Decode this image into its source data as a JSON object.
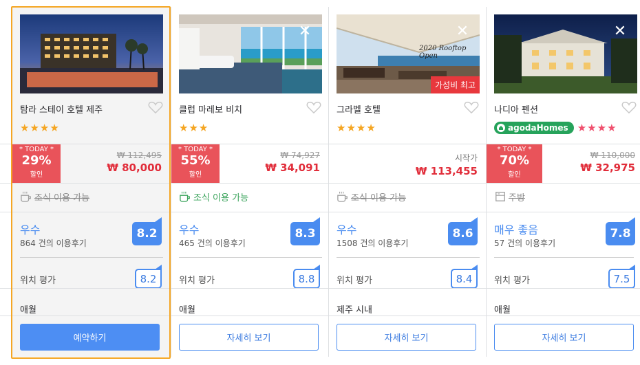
{
  "colors": {
    "accent": "#4a8cf0",
    "price_red": "#e12d3a",
    "badge_red": "#e9535a",
    "star": "#f5a623",
    "star_pink": "#f0506e",
    "selected_border": "#f5a623",
    "homes_green": "#26a35b"
  },
  "hotels": [
    {
      "name": "탐라 스테이 호텔 제주",
      "stars": 4,
      "today_label": "* TODAY *",
      "discount": "29%",
      "discount_label": "할인",
      "old_price": "₩ 112,495",
      "price": "₩ 80,000",
      "breakfast": "조식 이용 가능",
      "review_word": "우수",
      "review_count": "864 건의 이용후기",
      "score": "8.2",
      "location_label": "위치 평가",
      "location_score": "8.2",
      "area": "애월",
      "button": "예약하기",
      "icons": [
        "heart-icon",
        "star-icon",
        "coffee-cup-icon"
      ]
    },
    {
      "name": "클럽 마레보 비치",
      "stars": 3,
      "today_label": "* TODAY *",
      "discount": "55%",
      "discount_label": "할인",
      "old_price": "₩ 74,927",
      "price": "₩ 34,091",
      "breakfast": "조식 이용 가능",
      "review_word": "우수",
      "review_count": "465 건의 이용후기",
      "score": "8.3",
      "location_label": "위치 평가",
      "location_score": "8.8",
      "area": "애월",
      "button": "자세히 보기",
      "close": "✕"
    },
    {
      "name": "그라벨 호텔",
      "stars": 4,
      "from_label": "시작가",
      "price": "₩ 113,455",
      "breakfast": "조식 이용 가능",
      "review_word": "우수",
      "review_count": "1508 건의 이용후기",
      "score": "8.6",
      "location_label": "위치 평가",
      "location_score": "8.4",
      "area": "제주 시내",
      "button": "자세히 보기",
      "close": "✕",
      "promo_badge": "가성비 최고",
      "photo_text": "2020 Rooftop Open"
    },
    {
      "name": "나디아 펜션",
      "homes_badge": "agodaHomes",
      "stars": 4,
      "today_label": "* TODAY *",
      "discount": "70%",
      "discount_label": "할인",
      "old_price": "₩ 110,000",
      "price": "₩ 32,975",
      "breakfast": "주방",
      "review_word": "매우 좋음",
      "review_count": "57 건의 이용후기",
      "score": "7.8",
      "location_label": "위치 평가",
      "location_score": "7.5",
      "area": "애월",
      "button": "자세히 보기",
      "close": "✕"
    }
  ]
}
